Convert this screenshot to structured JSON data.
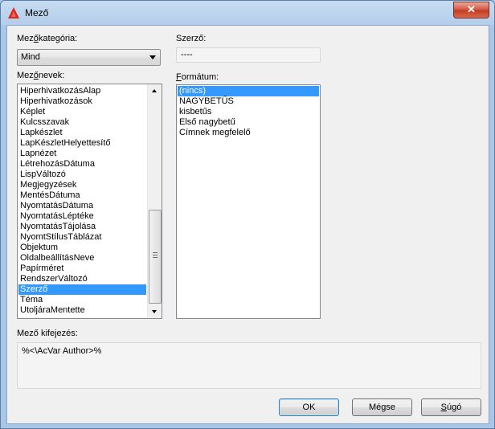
{
  "window": {
    "title": "Mező",
    "close_glyph": "✕"
  },
  "category": {
    "label_prefix": "Mez",
    "label_accel": "ő",
    "label_suffix": "kategória:",
    "value": "Mind"
  },
  "author": {
    "label": "Szerző:",
    "value": "----"
  },
  "fieldnames": {
    "label_prefix": "Mez",
    "label_accel": "ő",
    "label_suffix": "nevek:",
    "items": [
      "HiperhivatkozásAlap",
      "Hiperhivatkozások",
      "Képlet",
      "Kulcsszavak",
      "Lapkészlet",
      "LapKészletHelyettesítő",
      "Lapnézet",
      "LétrehozásDátuma",
      "LispVáltozó",
      "Megjegyzések",
      "MentésDátuma",
      "NyomtatásDátuma",
      "NyomtatásLéptéke",
      "NyomtatásTájolása",
      "NyomtStílusTáblázat",
      "Objektum",
      "OldalbeállításNeve",
      "Papírméret",
      "RendszerVáltozó",
      "Szerző",
      "Téma",
      "UtoljáraMentette"
    ],
    "selected": "Szerző"
  },
  "format": {
    "label_accel": "F",
    "label_suffix": "ormátum:",
    "items": [
      "(nincs)",
      "NAGYBETŰS",
      "kisbetűs",
      "Első nagybetű",
      "Címnek megfelelő"
    ],
    "selected": "(nincs)"
  },
  "expression": {
    "label": "Mező kifejezés:",
    "value": "%<\\AcVar Author>%"
  },
  "buttons": {
    "ok": "OK",
    "cancel": "Mégse",
    "help_accel": "S",
    "help_rest": "úgó"
  },
  "colors": {
    "selection": "#3399ff",
    "close": "#c23a22"
  }
}
